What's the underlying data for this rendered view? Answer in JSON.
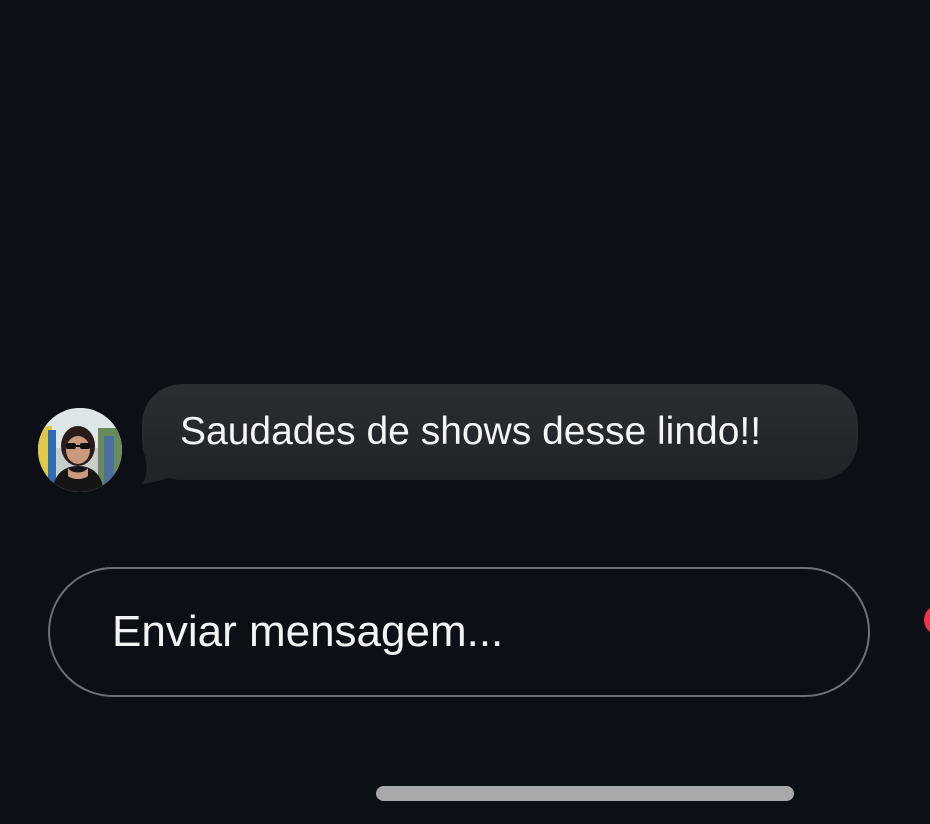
{
  "conversation": {
    "message": {
      "text": "Saudades de shows desse lindo!!",
      "avatar_icon": "user-avatar-photo"
    }
  },
  "composer": {
    "placeholder": "Enviar mensagem..."
  },
  "colors": {
    "background": "#0c1016",
    "bubble": "#25292e",
    "composer_border": "#6d7075",
    "notification_dot": "#f2334a",
    "home_indicator": "#a8a8aa"
  }
}
